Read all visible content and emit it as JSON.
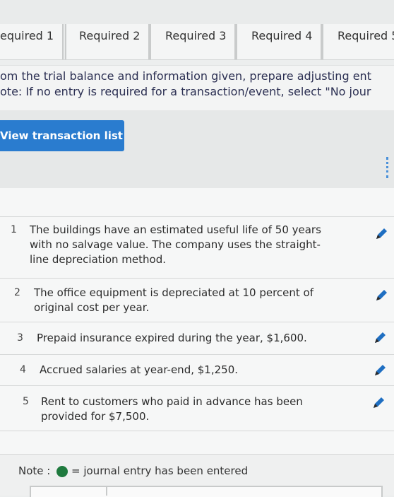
{
  "tabs": [
    {
      "label": "equired 1"
    },
    {
      "label": "Required 2"
    },
    {
      "label": "Required 3"
    },
    {
      "label": "Required 4"
    },
    {
      "label": "Required 5"
    }
  ],
  "instructions": {
    "line1": "om the trial balance and information given, prepare adjusting ent",
    "line2": "ote: If no entry is required for a transaction/event, select \"No jour"
  },
  "toolbar": {
    "view_button_label": "View transaction list"
  },
  "transactions": [
    {
      "number": "1",
      "text": "The buildings have an estimated useful life of 50 years\nwith no salvage value. The company uses the straight-\nline depreciation method."
    },
    {
      "number": "2",
      "text": "The office equipment is depreciated at 10 percent of\noriginal cost per year."
    },
    {
      "number": "3",
      "text": "Prepaid insurance expired during the year, $1,600."
    },
    {
      "number": "4",
      "text": "Accrued salaries at year-end, $1,250."
    },
    {
      "number": "5",
      "text": "Rent to customers who paid in advance has been\nprovided for $7,500."
    }
  ],
  "note": {
    "label": "Note :",
    "description": "= journal entry has been entered",
    "dot_color": "#1f7a3e"
  },
  "colors": {
    "accent": "#2a7ccf",
    "edit_icon": "#1f6fc2"
  }
}
